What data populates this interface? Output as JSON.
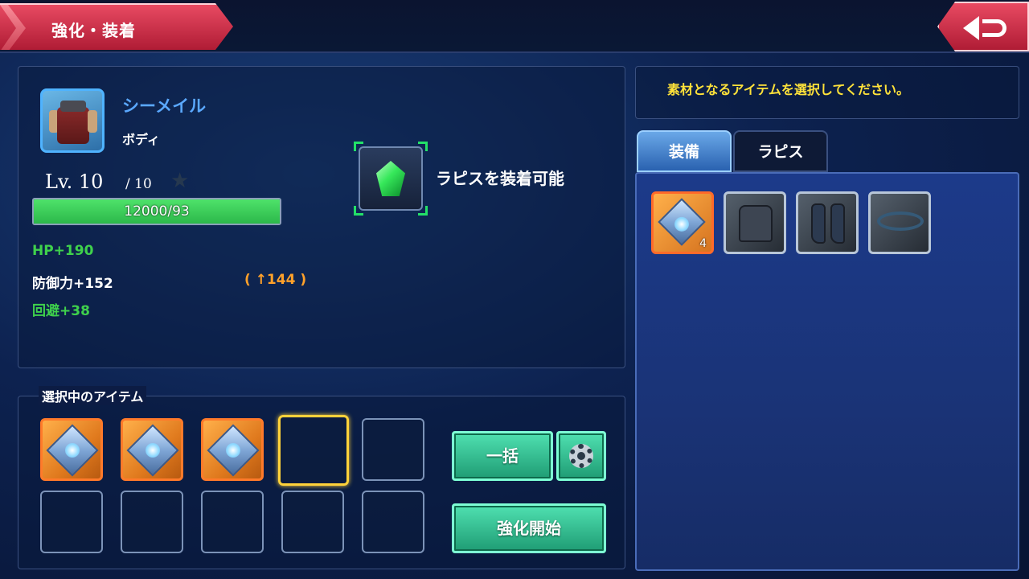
{
  "header": {
    "title": "強化・装着",
    "back_icon": "return-arrow-icon"
  },
  "item": {
    "name": "シーメイル",
    "type": "ボディ",
    "icon": "body-armor-icon",
    "level_label": "Lv. 10",
    "level_max": "/ 10",
    "exp_text": "12000/93",
    "exp_fill_fraction": 1.0,
    "stats": {
      "hp": "HP+190",
      "def": "防御力+152",
      "def_bonus": "( ↑144 )",
      "eva": "回避+38"
    }
  },
  "lapis": {
    "status_text": "ラピスを装着可能",
    "icon": "green-gem-icon"
  },
  "selection": {
    "label": "選択中のアイテム",
    "bulk_button": "一括",
    "settings_icon": "gear-icon",
    "start_button": "強化開始"
  },
  "message": "素材となるアイテムを選択してください。",
  "tabs": [
    {
      "label": "装備",
      "active": true
    },
    {
      "label": "ラピス",
      "active": false
    }
  ],
  "inventory": {
    "stone_count": "4",
    "items": [
      "enhance-stone-icon",
      "vest-icon",
      "boots-icon",
      "belt-icon"
    ]
  },
  "colors": {
    "accent_red": "#d02a44",
    "name_blue": "#5aa8ff",
    "stat_green": "#3fd14c",
    "bonus_orange": "#ffa12a",
    "message_yellow": "#ffe23a",
    "button_green": "#2fbf8c"
  }
}
